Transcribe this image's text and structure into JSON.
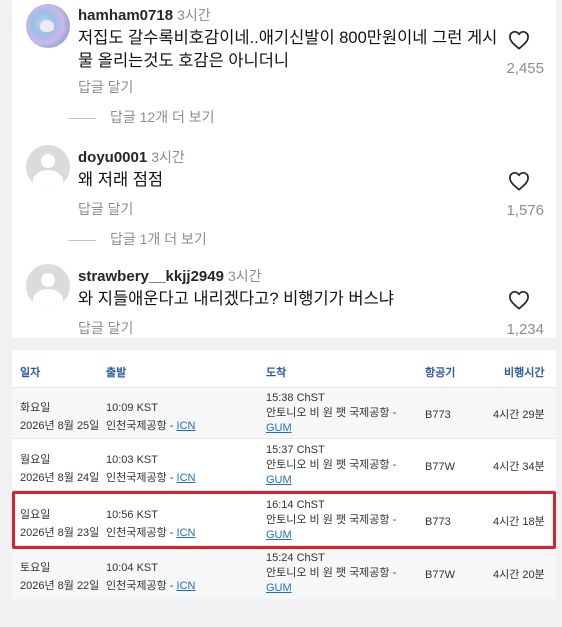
{
  "comments": [
    {
      "username": "hamham0718",
      "time": "3시간",
      "text": "저집도 갈수록비호감이네..애기신발이 800만원이네 그런 게시물 올리는것도 호감은 아니더니",
      "reply_label": "답글 달기",
      "likes": "2,455",
      "more_replies": "답글 12개 더 보기",
      "avatar": "profile-photo"
    },
    {
      "username": "doyu0001",
      "time": "3시간",
      "text": "왜 저래 점점",
      "reply_label": "답글 달기",
      "likes": "1,576",
      "more_replies": "답글 1개 더 보기",
      "avatar": "default-user-icon"
    },
    {
      "username": "strawbery__kkjj2949",
      "time": "3시간",
      "text": "와 지들애운다고 내리겠다고? 비행기가 버스냐",
      "reply_label": "답글 달기",
      "likes": "1,234",
      "avatar": "default-user-icon"
    }
  ],
  "flights": {
    "headers": {
      "date": "일자",
      "departure": "출발",
      "arrival": "도착",
      "aircraft": "항공기",
      "duration": "비행시간"
    },
    "rows": [
      {
        "day": "화요일",
        "date": "2026년 8월 25일",
        "dep_time": "10:09 KST",
        "dep_airport": "인천국제공항 -",
        "dep_code": "ICN",
        "arr_time": "15:38 ChST",
        "arr_airport": "안토니오 비 원 팻 국제공항 -",
        "arr_code": "GUM",
        "aircraft": "B773",
        "duration": "4시간 29분"
      },
      {
        "day": "월요일",
        "date": "2026년 8월 24일",
        "dep_time": "10:03 KST",
        "dep_airport": "인천국제공항 -",
        "dep_code": "ICN",
        "arr_time": "15:37 ChST",
        "arr_airport": "안토니오 비 원 팻 국제공항 -",
        "arr_code": "GUM",
        "aircraft": "B77W",
        "duration": "4시간 34분"
      },
      {
        "day": "일요일",
        "date": "2026년 8월 23일",
        "dep_time": "10:56 KST",
        "dep_airport": "인천국제공항 -",
        "dep_code": "ICN",
        "arr_time": "16:14 ChST",
        "arr_airport": "안토니오 비 원 팻 국제공항 -",
        "arr_code": "GUM",
        "aircraft": "B773",
        "duration": "4시간 18분",
        "highlighted": true
      },
      {
        "day": "토요일",
        "date": "2026년 8월 22일",
        "dep_time": "10:04 KST",
        "dep_airport": "인천국제공항 -",
        "dep_code": "ICN",
        "arr_time": "15:24 ChST",
        "arr_airport": "안토니오 비 원 팻 국제공항 -",
        "arr_code": "GUM",
        "aircraft": "B77W",
        "duration": "4시간 20분"
      }
    ]
  },
  "colors": {
    "header_text": "#2a5aa8",
    "link": "#1f6fc9",
    "highlight_border": "#d6232d",
    "muted_text": "#8e8e8e"
  }
}
